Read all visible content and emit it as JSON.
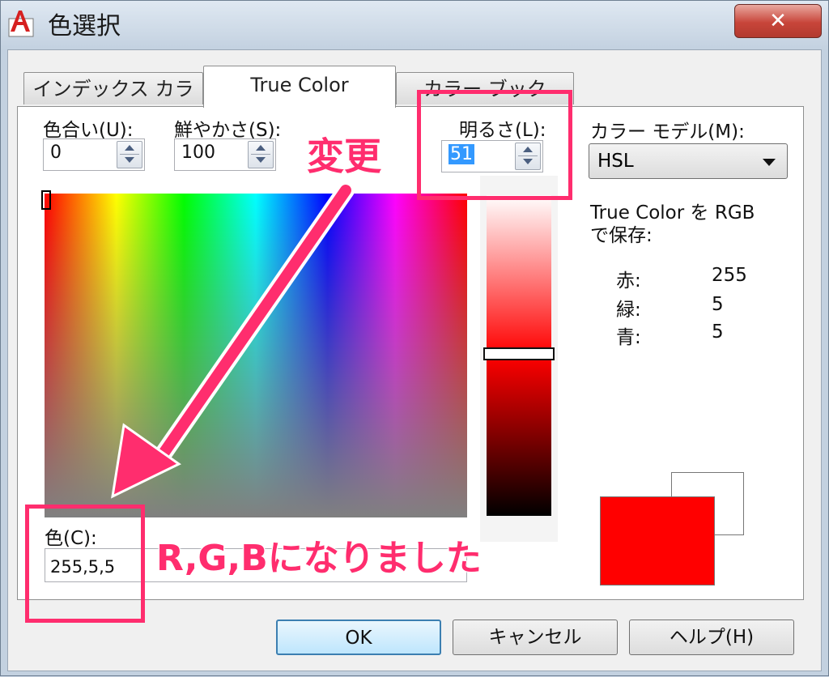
{
  "window": {
    "title": "色選択",
    "close_label": "✕"
  },
  "tabs": [
    {
      "label": "インデックス カラー"
    },
    {
      "label": "True Color"
    },
    {
      "label": "カラー ブック"
    }
  ],
  "controls": {
    "hue": {
      "label": "色合い(U):",
      "value": "0"
    },
    "saturation": {
      "label": "鮮やかさ(S):",
      "value": "100"
    },
    "luminance": {
      "label": "明るさ(L):",
      "value": "51"
    },
    "color_model": {
      "label": "カラー モデル(M):",
      "value": "HSL"
    }
  },
  "rgb_info": {
    "heading_line1": "True Color を RGB",
    "heading_line2": "で保存:",
    "red_label": "赤:",
    "red": "255",
    "green_label": "緑:",
    "green": "5",
    "blue_label": "青:",
    "blue": "5"
  },
  "color_field": {
    "label": "色(C):",
    "value": "255,5,5"
  },
  "preview": {
    "new_color": "#ff0505",
    "old_color": "#ffffff"
  },
  "buttons": {
    "ok": "OK",
    "cancel": "キャンセル",
    "help": "ヘルプ(H)"
  },
  "annotations": {
    "change_label": "変更",
    "result_label": "R,G,Bになりました",
    "color": "#ff2d6e"
  }
}
